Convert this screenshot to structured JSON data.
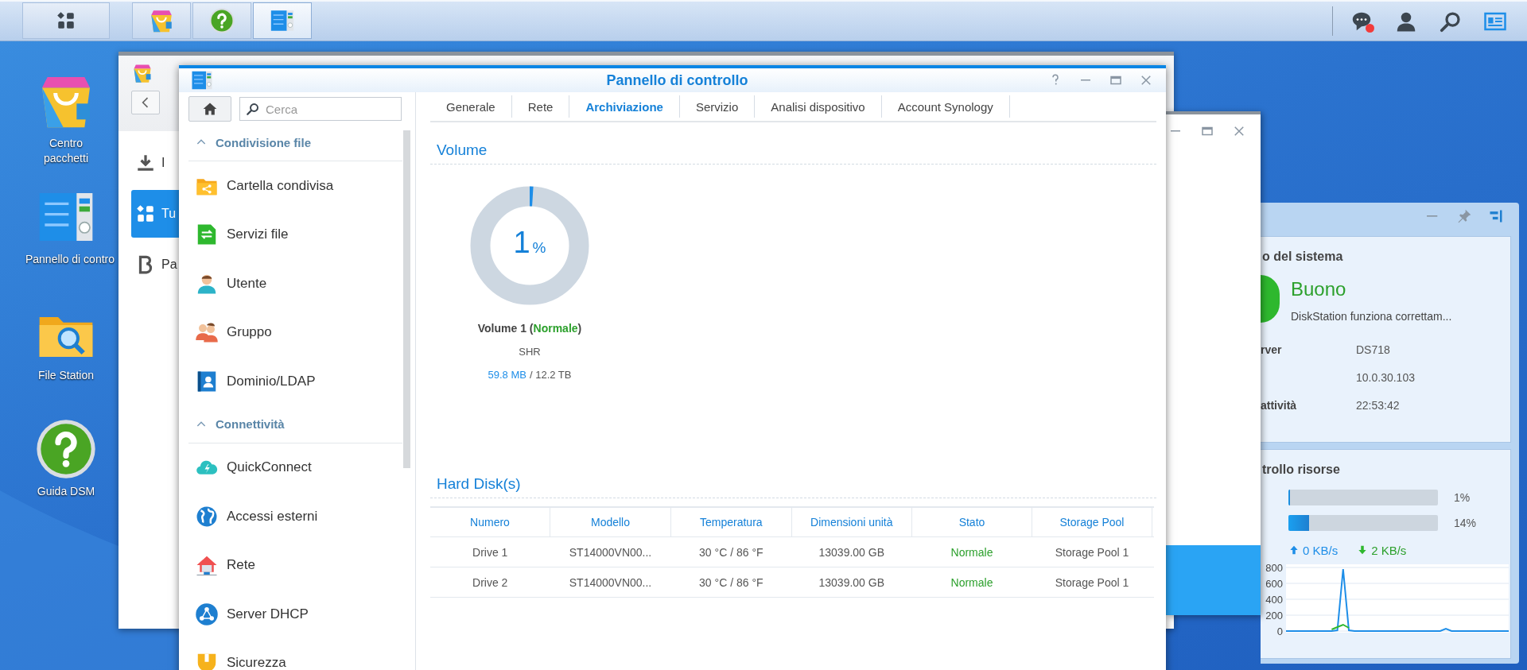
{
  "taskbar": {
    "apps": [
      {
        "kind": "apps",
        "selected": false
      },
      {
        "kind": "package",
        "selected": false
      },
      {
        "kind": "help",
        "selected": false
      },
      {
        "kind": "control-panel",
        "selected": true
      }
    ],
    "tray": [
      {
        "kind": "chat",
        "badge": true
      },
      {
        "kind": "user"
      },
      {
        "kind": "search"
      },
      {
        "kind": "card"
      }
    ]
  },
  "desktop": {
    "icons": [
      {
        "kind": "package",
        "label": "Centro pacchetti"
      },
      {
        "kind": "control-panel",
        "label": "Pannello di contro"
      },
      {
        "kind": "folder",
        "label": "File Station"
      },
      {
        "kind": "help",
        "label": "Guida DSM"
      }
    ]
  },
  "package_window": {
    "nav": [
      {
        "kind": "download",
        "label": "I",
        "selected": false
      },
      {
        "kind": "grid",
        "label": "Tu",
        "selected": true
      },
      {
        "kind": "beta",
        "label": "Pa",
        "selected": false
      }
    ]
  },
  "control_panel": {
    "title": "Pannello di controllo",
    "search": {
      "placeholder": "Cerca"
    },
    "sidebar": [
      {
        "title": "Condivisione file",
        "expanded": true,
        "items": [
          {
            "kind": "shared-folder",
            "label": "Cartella condivisa"
          },
          {
            "kind": "file-services",
            "label": "Servizi file"
          },
          {
            "kind": "user",
            "label": "Utente"
          },
          {
            "kind": "group",
            "label": "Gruppo"
          },
          {
            "kind": "directory",
            "label": "Dominio/LDAP"
          }
        ]
      },
      {
        "title": "Connettività",
        "expanded": true,
        "items": [
          {
            "kind": "cloud",
            "label": "QuickConnect"
          },
          {
            "kind": "globe",
            "label": "Accessi esterni"
          },
          {
            "kind": "house",
            "label": "Rete"
          },
          {
            "kind": "nodes",
            "label": "Server DHCP"
          },
          {
            "kind": "shield",
            "label": "Sicurezza"
          }
        ]
      }
    ],
    "tabs": [
      {
        "label": "Generale",
        "selected": false
      },
      {
        "label": "Rete",
        "selected": false
      },
      {
        "label": "Archiviazione",
        "selected": true
      },
      {
        "label": "Servizio",
        "selected": false
      },
      {
        "label": "Analisi dispositivo",
        "selected": false
      },
      {
        "label": "Account Synology",
        "selected": false
      }
    ],
    "volume": {
      "heading": "Volume",
      "percent": "1",
      "unit": "%",
      "level": 0.01,
      "name": "Volume 1 (*Normale*)",
      "type": "SHR",
      "used": "59.8 MB",
      "total": "/ 12.2 TB"
    },
    "disks": {
      "heading": "Hard Disk(s)",
      "columns": [
        {
          "label": "Numero",
          "kind": "text"
        },
        {
          "label": "Modello",
          "kind": "text"
        },
        {
          "label": "Temperatura",
          "kind": "text"
        },
        {
          "label": "Dimensioni unità",
          "kind": "text"
        },
        {
          "label": "Stato",
          "kind": "status"
        },
        {
          "label": "Storage Pool",
          "kind": "text"
        }
      ],
      "rows": [
        [
          "Drive 1",
          "ST14000VN00...",
          "30 °C / 86 °F",
          "13039.00 GB",
          "Normale",
          "Storage Pool 1"
        ],
        [
          "Drive 2",
          "ST14000VN00...",
          "30 °C / 86 °F",
          "13039.00 GB",
          "Normale",
          "Storage Pool 1"
        ]
      ]
    }
  },
  "widget": {
    "health": {
      "title": "o del sistema",
      "status": "Buono",
      "message": "DiskStation funziona correttam...",
      "rows": [
        {
          "label": "rver",
          "value": "DS718"
        },
        {
          "value": "10.0.30.103"
        },
        {
          "label": "attività",
          "value": "22:53:42"
        }
      ]
    },
    "resources": {
      "title": "trollo risorse",
      "meters": [
        {
          "level": 0.01,
          "reading": "1%"
        },
        {
          "level": 0.14,
          "reading": "14%"
        }
      ],
      "upload": "0 KB/s",
      "download": "2 KB/s",
      "chart_data": {
        "type": "line",
        "grid": true,
        "ylim": [
          0,
          800
        ],
        "yticks": [
          0,
          200,
          400,
          600,
          800
        ],
        "series": [
          {
            "color": "#1e8ee8",
            "values": [
              0,
              0,
              0,
              0,
              0,
              0,
              0,
              0,
              0,
              10,
              780,
              10,
              0,
              0,
              0,
              0,
              0,
              0,
              0,
              0,
              0,
              0,
              0,
              0,
              0,
              0,
              0,
              0,
              30,
              0,
              0,
              0,
              0,
              0,
              0,
              0,
              0,
              0,
              0,
              0
            ]
          },
          {
            "color": "#2eb82e",
            "values": [
              null,
              null,
              null,
              null,
              null,
              null,
              null,
              null,
              20,
              50,
              80,
              40,
              null,
              null,
              null,
              null,
              null,
              null,
              null,
              null,
              null,
              null,
              null,
              null,
              null,
              null,
              null,
              null,
              null,
              null,
              null,
              null,
              null,
              null,
              null,
              null,
              null,
              null,
              null,
              null
            ]
          }
        ]
      }
    }
  }
}
